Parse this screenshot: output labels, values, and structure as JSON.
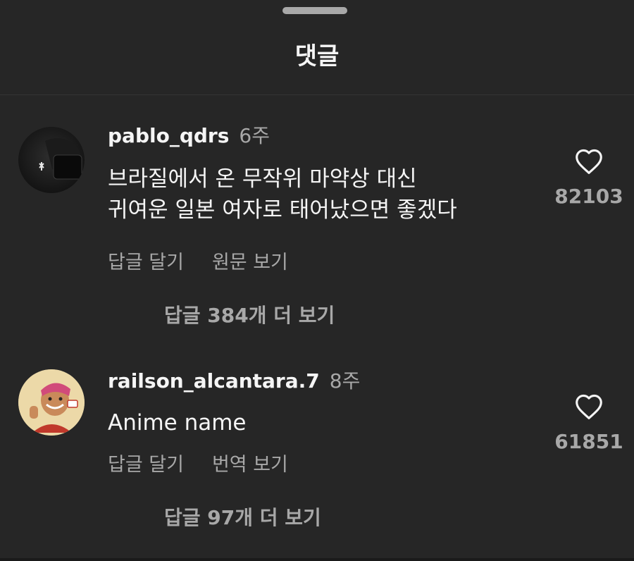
{
  "header": {
    "title": "댓글"
  },
  "comments": [
    {
      "username": "pablo_qdrs",
      "time": "6주",
      "text_lines": [
        "브라질에서 온 무작위 마약상 대신",
        "귀여운 일본 여자로 태어났으면 좋겠다"
      ],
      "actions": [
        "답글 달기",
        "원문 보기"
      ],
      "likes": "82103",
      "more_replies": "답글 384개 더 보기"
    },
    {
      "username": "railson_alcantara.7",
      "time": "8주",
      "text_lines": [
        "Anime name"
      ],
      "actions": [
        "답글 달기",
        "번역 보기"
      ],
      "likes": "61851",
      "more_replies": "답글 97개 더 보기"
    }
  ],
  "icons": {
    "like": "heart-outline-icon",
    "grabber": "drag-handle"
  },
  "colors": {
    "background": "#262626",
    "primary_text": "#f5f5f5",
    "secondary_text": "#a8a8a8"
  }
}
